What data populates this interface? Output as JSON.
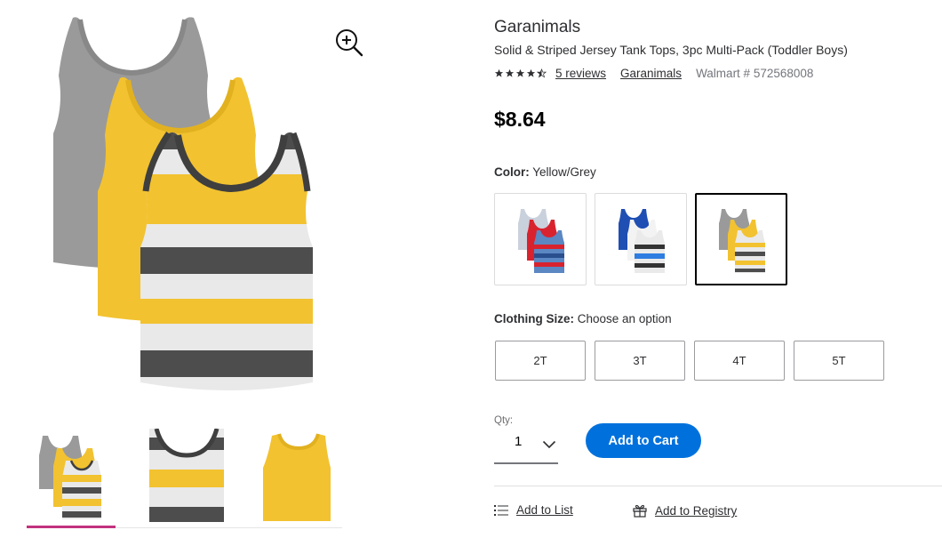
{
  "product": {
    "brand": "Garanimals",
    "name": "Solid & Striped Jersey Tank Tops, 3pc Multi-Pack (Toddler Boys)",
    "rating": 4.5,
    "reviews_label": "5 reviews",
    "brand_link": "Garanimals",
    "item_number": "Walmart # 572568008",
    "price": "$8.64"
  },
  "color": {
    "label": "Color:",
    "selected": "Yellow/Grey",
    "swatch_names": [
      "Red/Grey/Blue",
      "Blue/White",
      "Yellow/Grey"
    ],
    "selected_index": 2
  },
  "size": {
    "label": "Clothing Size:",
    "prompt": "Choose an option",
    "options": [
      "2T",
      "3T",
      "4T",
      "5T"
    ]
  },
  "quantity": {
    "label": "Qty:",
    "value": "1"
  },
  "actions": {
    "add_to_cart": "Add to Cart",
    "add_to_list": "Add to List",
    "add_to_registry": "Add to Registry"
  },
  "colors": {
    "primary_blue": "#0071dc",
    "active_thumb": "#c1327e",
    "tank_yellow": "#f2c230",
    "tank_grey": "#9a9a9a",
    "tank_dark": "#4a4a4a"
  },
  "icons": {
    "zoom": "zoom-in-icon",
    "qty_dropdown": "chevron-down-icon",
    "list": "list-icon",
    "registry": "gift-icon"
  }
}
